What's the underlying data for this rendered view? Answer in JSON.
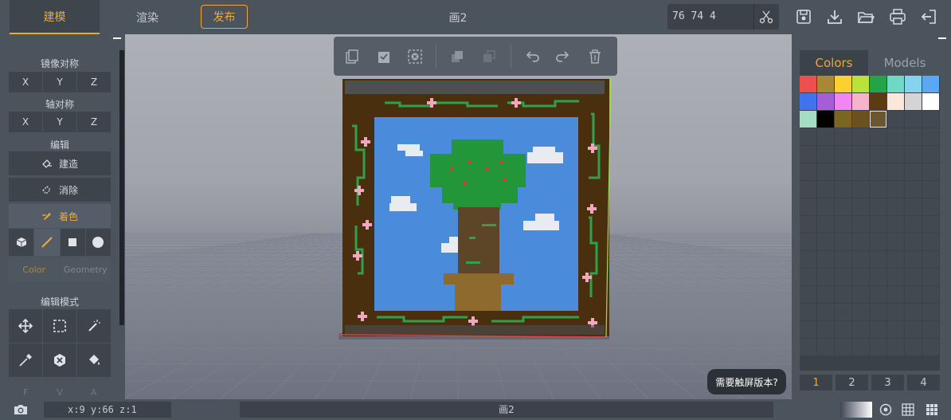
{
  "topbar": {
    "tab_model": "建模",
    "tab_render": "渲染",
    "publish": "发布",
    "title": "画2",
    "coords": "76  74  4"
  },
  "left_panel": {
    "mirror_label": "镜像对称",
    "mirror_axes": [
      "X",
      "Y",
      "Z"
    ],
    "axis_label": "轴对称",
    "axis_axes": [
      "X",
      "Y",
      "Z"
    ],
    "edit_label": "编辑",
    "build": "建造",
    "erase": "消除",
    "paint": "着色",
    "color_tab": "Color",
    "geometry_tab": "Geometry",
    "edit_mode_label": "编辑模式",
    "bottom_keys": [
      "F",
      "V",
      "A"
    ]
  },
  "right_panel": {
    "tab_colors": "Colors",
    "tab_models": "Models",
    "palette": [
      "#ef4f4f",
      "#a98835",
      "#fbd02f",
      "#b9e23d",
      "#23a547",
      "#6ed9c7",
      "#84d3ef",
      "#5aa8f2",
      "#4173ef",
      "#a45ed8",
      "#f385f3",
      "#f6b3cc",
      "#5c3a12",
      "#fce8d8",
      "#d4d4d4",
      "#ffffff",
      "#a4dcc4",
      "#000000",
      "#7a6622",
      "#6c5120",
      "#6a5731"
    ],
    "selected_index": 20,
    "pages": [
      "1",
      "2",
      "3",
      "4"
    ],
    "selected_page": 0
  },
  "viewport": {
    "touch_tip": "需要触屏版本?"
  },
  "bottombar": {
    "status": "x:9 y:66 z:1",
    "title": "画2"
  },
  "colors": {
    "accent": "#f0a830",
    "panel": "#4b535c",
    "field": "#3b4249"
  }
}
